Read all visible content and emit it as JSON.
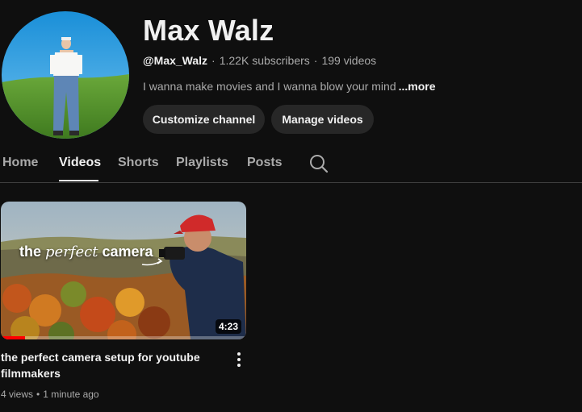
{
  "channel": {
    "name": "Max Walz",
    "handle": "@Max_Walz",
    "subscribers": "1.22K subscribers",
    "videos": "199 videos",
    "separator": "·",
    "description": "I wanna make movies and I wanna blow your mind",
    "more_label": "...more"
  },
  "actions": {
    "customize_label": "Customize channel",
    "manage_label": "Manage videos"
  },
  "tabs": [
    {
      "label": "Home",
      "active": false
    },
    {
      "label": "Videos",
      "active": true
    },
    {
      "label": "Shorts",
      "active": false
    },
    {
      "label": "Playlists",
      "active": false
    },
    {
      "label": "Posts",
      "active": false
    }
  ],
  "tab_search_icon": "search-icon",
  "videos": [
    {
      "thumbnail_text": {
        "w1": "the",
        "w2": "perfect",
        "w3": "camera"
      },
      "duration": "4:23",
      "watch_progress": 0.1,
      "title": "the perfect camera setup for youtube filmmakers",
      "views": "4 views",
      "age": "1 minute ago",
      "menu_icon": "more-vert-icon"
    }
  ],
  "colors": {
    "background": "#0f0f0f",
    "text_primary": "#f1f1f1",
    "text_secondary": "#aaaaaa",
    "button_bg": "#272727",
    "progress_red": "#ff0000"
  }
}
